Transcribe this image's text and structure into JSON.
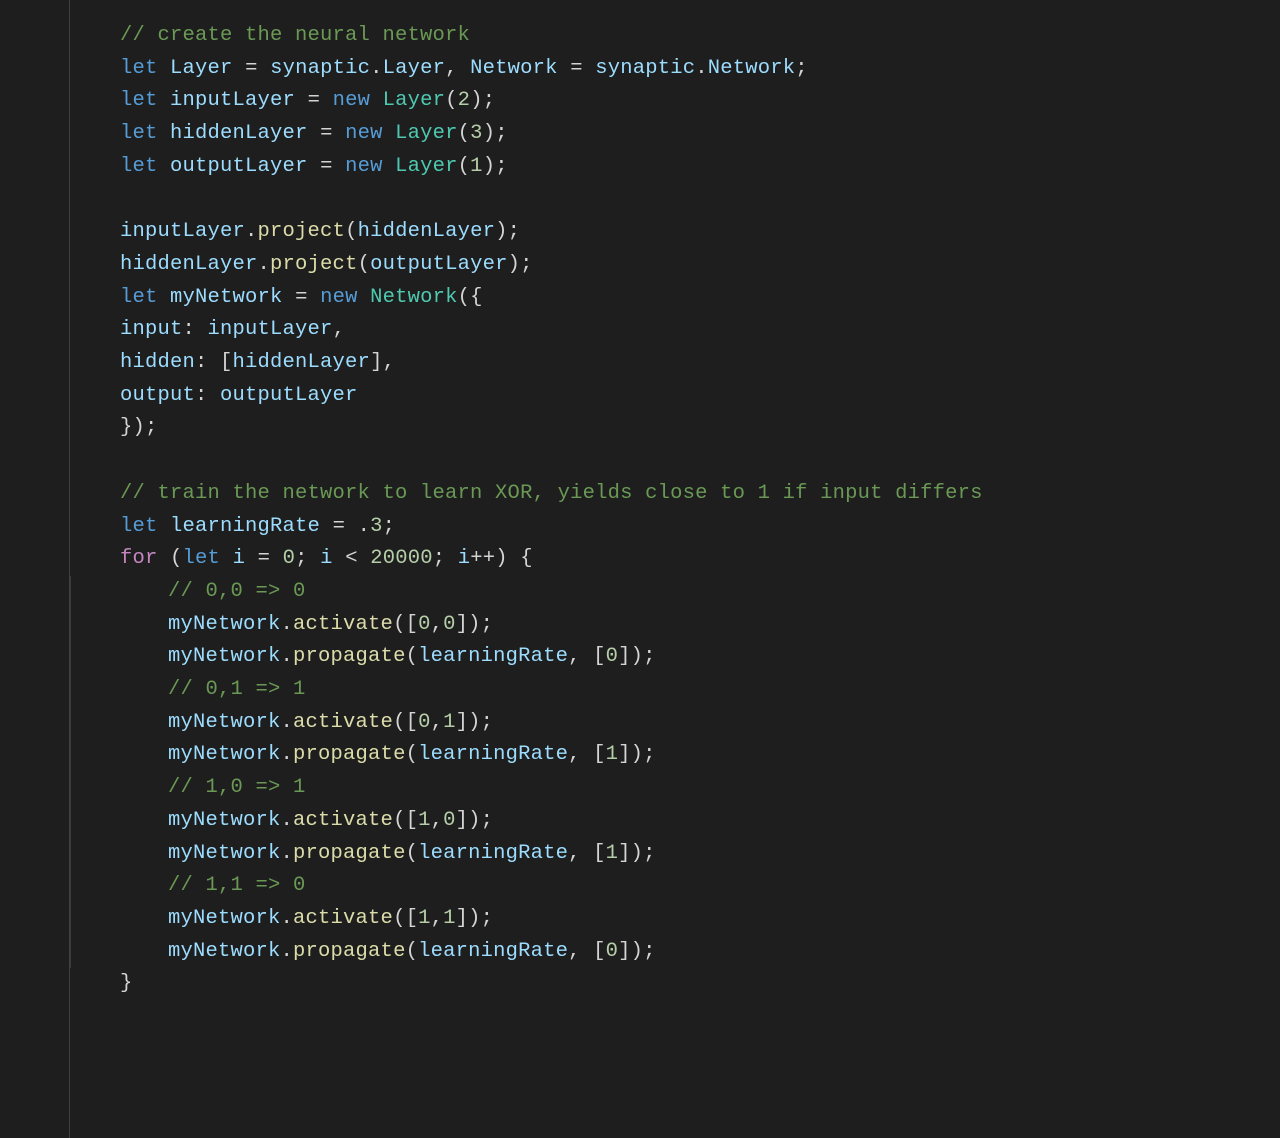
{
  "language": "javascript",
  "theme": "vscode-dark-plus",
  "colors": {
    "background": "#1e1e1e",
    "gutter_border": "#404040",
    "indent_guide": "#3a3a3a",
    "comment": "#6a9955",
    "keyword": "#569cd6",
    "control": "#c586c0",
    "type": "#4ec9b0",
    "variable": "#9cdcfe",
    "function": "#dcdcaa",
    "number": "#b5cea8",
    "punctuation": "#d4d4d4"
  },
  "lines": [
    {
      "indent": 0,
      "tokens": [
        {
          "t": "comment",
          "v": "// create the neural network"
        }
      ]
    },
    {
      "indent": 0,
      "tokens": [
        {
          "t": "keyword",
          "v": "let"
        },
        {
          "t": "plain",
          "v": " "
        },
        {
          "t": "var",
          "v": "Layer"
        },
        {
          "t": "plain",
          "v": " "
        },
        {
          "t": "punct",
          "v": "="
        },
        {
          "t": "plain",
          "v": " "
        },
        {
          "t": "var",
          "v": "synaptic"
        },
        {
          "t": "punct",
          "v": "."
        },
        {
          "t": "var",
          "v": "Layer"
        },
        {
          "t": "punct",
          "v": ", "
        },
        {
          "t": "var",
          "v": "Network"
        },
        {
          "t": "plain",
          "v": " "
        },
        {
          "t": "punct",
          "v": "="
        },
        {
          "t": "plain",
          "v": " "
        },
        {
          "t": "var",
          "v": "synaptic"
        },
        {
          "t": "punct",
          "v": "."
        },
        {
          "t": "var",
          "v": "Network"
        },
        {
          "t": "punct",
          "v": ";"
        }
      ]
    },
    {
      "indent": 0,
      "tokens": [
        {
          "t": "keyword",
          "v": "let"
        },
        {
          "t": "plain",
          "v": " "
        },
        {
          "t": "var",
          "v": "inputLayer"
        },
        {
          "t": "plain",
          "v": " "
        },
        {
          "t": "punct",
          "v": "="
        },
        {
          "t": "plain",
          "v": " "
        },
        {
          "t": "keyword",
          "v": "new"
        },
        {
          "t": "plain",
          "v": " "
        },
        {
          "t": "type",
          "v": "Layer"
        },
        {
          "t": "punct",
          "v": "("
        },
        {
          "t": "num",
          "v": "2"
        },
        {
          "t": "punct",
          "v": ");"
        }
      ]
    },
    {
      "indent": 0,
      "tokens": [
        {
          "t": "keyword",
          "v": "let"
        },
        {
          "t": "plain",
          "v": " "
        },
        {
          "t": "var",
          "v": "hiddenLayer"
        },
        {
          "t": "plain",
          "v": " "
        },
        {
          "t": "punct",
          "v": "="
        },
        {
          "t": "plain",
          "v": " "
        },
        {
          "t": "keyword",
          "v": "new"
        },
        {
          "t": "plain",
          "v": " "
        },
        {
          "t": "type",
          "v": "Layer"
        },
        {
          "t": "punct",
          "v": "("
        },
        {
          "t": "num",
          "v": "3"
        },
        {
          "t": "punct",
          "v": ");"
        }
      ]
    },
    {
      "indent": 0,
      "tokens": [
        {
          "t": "keyword",
          "v": "let"
        },
        {
          "t": "plain",
          "v": " "
        },
        {
          "t": "var",
          "v": "outputLayer"
        },
        {
          "t": "plain",
          "v": " "
        },
        {
          "t": "punct",
          "v": "="
        },
        {
          "t": "plain",
          "v": " "
        },
        {
          "t": "keyword",
          "v": "new"
        },
        {
          "t": "plain",
          "v": " "
        },
        {
          "t": "type",
          "v": "Layer"
        },
        {
          "t": "punct",
          "v": "("
        },
        {
          "t": "num",
          "v": "1"
        },
        {
          "t": "punct",
          "v": ");"
        }
      ]
    },
    {
      "indent": 0,
      "tokens": [
        {
          "t": "plain",
          "v": " "
        }
      ]
    },
    {
      "indent": 0,
      "tokens": [
        {
          "t": "var",
          "v": "inputLayer"
        },
        {
          "t": "punct",
          "v": "."
        },
        {
          "t": "func",
          "v": "project"
        },
        {
          "t": "punct",
          "v": "("
        },
        {
          "t": "var",
          "v": "hiddenLayer"
        },
        {
          "t": "punct",
          "v": ");"
        }
      ]
    },
    {
      "indent": 0,
      "tokens": [
        {
          "t": "var",
          "v": "hiddenLayer"
        },
        {
          "t": "punct",
          "v": "."
        },
        {
          "t": "func",
          "v": "project"
        },
        {
          "t": "punct",
          "v": "("
        },
        {
          "t": "var",
          "v": "outputLayer"
        },
        {
          "t": "punct",
          "v": ");"
        }
      ]
    },
    {
      "indent": 0,
      "tokens": [
        {
          "t": "keyword",
          "v": "let"
        },
        {
          "t": "plain",
          "v": " "
        },
        {
          "t": "var",
          "v": "myNetwork"
        },
        {
          "t": "plain",
          "v": " "
        },
        {
          "t": "punct",
          "v": "="
        },
        {
          "t": "plain",
          "v": " "
        },
        {
          "t": "keyword",
          "v": "new"
        },
        {
          "t": "plain",
          "v": " "
        },
        {
          "t": "type",
          "v": "Network"
        },
        {
          "t": "punct",
          "v": "({"
        }
      ]
    },
    {
      "indent": 0,
      "tokens": [
        {
          "t": "var",
          "v": "input"
        },
        {
          "t": "punct",
          "v": ": "
        },
        {
          "t": "var",
          "v": "inputLayer"
        },
        {
          "t": "punct",
          "v": ","
        }
      ]
    },
    {
      "indent": 0,
      "tokens": [
        {
          "t": "var",
          "v": "hidden"
        },
        {
          "t": "punct",
          "v": ": ["
        },
        {
          "t": "var",
          "v": "hiddenLayer"
        },
        {
          "t": "punct",
          "v": "],"
        }
      ]
    },
    {
      "indent": 0,
      "tokens": [
        {
          "t": "var",
          "v": "output"
        },
        {
          "t": "punct",
          "v": ": "
        },
        {
          "t": "var",
          "v": "outputLayer"
        }
      ]
    },
    {
      "indent": 0,
      "tokens": [
        {
          "t": "punct",
          "v": "});"
        }
      ]
    },
    {
      "indent": 0,
      "tokens": [
        {
          "t": "plain",
          "v": " "
        }
      ]
    },
    {
      "indent": 0,
      "tokens": [
        {
          "t": "comment",
          "v": "// train the network to learn XOR, yields close to 1 if input differs"
        }
      ]
    },
    {
      "indent": 0,
      "tokens": [
        {
          "t": "keyword",
          "v": "let"
        },
        {
          "t": "plain",
          "v": " "
        },
        {
          "t": "var",
          "v": "learningRate"
        },
        {
          "t": "plain",
          "v": " "
        },
        {
          "t": "punct",
          "v": "="
        },
        {
          "t": "plain",
          "v": " "
        },
        {
          "t": "punct",
          "v": "."
        },
        {
          "t": "num",
          "v": "3"
        },
        {
          "t": "punct",
          "v": ";"
        }
      ]
    },
    {
      "indent": 0,
      "tokens": [
        {
          "t": "control",
          "v": "for"
        },
        {
          "t": "plain",
          "v": " "
        },
        {
          "t": "punct",
          "v": "("
        },
        {
          "t": "keyword",
          "v": "let"
        },
        {
          "t": "plain",
          "v": " "
        },
        {
          "t": "var",
          "v": "i"
        },
        {
          "t": "plain",
          "v": " "
        },
        {
          "t": "punct",
          "v": "="
        },
        {
          "t": "plain",
          "v": " "
        },
        {
          "t": "num",
          "v": "0"
        },
        {
          "t": "punct",
          "v": "; "
        },
        {
          "t": "var",
          "v": "i"
        },
        {
          "t": "plain",
          "v": " "
        },
        {
          "t": "punct",
          "v": "<"
        },
        {
          "t": "plain",
          "v": " "
        },
        {
          "t": "num",
          "v": "20000"
        },
        {
          "t": "punct",
          "v": "; "
        },
        {
          "t": "var",
          "v": "i"
        },
        {
          "t": "punct",
          "v": "++) {"
        }
      ]
    },
    {
      "indent": 1,
      "tokens": [
        {
          "t": "comment",
          "v": "// 0,0 => 0"
        }
      ]
    },
    {
      "indent": 1,
      "tokens": [
        {
          "t": "var",
          "v": "myNetwork"
        },
        {
          "t": "punct",
          "v": "."
        },
        {
          "t": "func",
          "v": "activate"
        },
        {
          "t": "punct",
          "v": "(["
        },
        {
          "t": "num",
          "v": "0"
        },
        {
          "t": "punct",
          "v": ","
        },
        {
          "t": "num",
          "v": "0"
        },
        {
          "t": "punct",
          "v": "]);"
        }
      ]
    },
    {
      "indent": 1,
      "tokens": [
        {
          "t": "var",
          "v": "myNetwork"
        },
        {
          "t": "punct",
          "v": "."
        },
        {
          "t": "func",
          "v": "propagate"
        },
        {
          "t": "punct",
          "v": "("
        },
        {
          "t": "var",
          "v": "learningRate"
        },
        {
          "t": "punct",
          "v": ", ["
        },
        {
          "t": "num",
          "v": "0"
        },
        {
          "t": "punct",
          "v": "]);"
        }
      ]
    },
    {
      "indent": 1,
      "tokens": [
        {
          "t": "comment",
          "v": "// 0,1 => 1"
        }
      ]
    },
    {
      "indent": 1,
      "tokens": [
        {
          "t": "var",
          "v": "myNetwork"
        },
        {
          "t": "punct",
          "v": "."
        },
        {
          "t": "func",
          "v": "activate"
        },
        {
          "t": "punct",
          "v": "(["
        },
        {
          "t": "num",
          "v": "0"
        },
        {
          "t": "punct",
          "v": ","
        },
        {
          "t": "num",
          "v": "1"
        },
        {
          "t": "punct",
          "v": "]);"
        }
      ]
    },
    {
      "indent": 1,
      "tokens": [
        {
          "t": "var",
          "v": "myNetwork"
        },
        {
          "t": "punct",
          "v": "."
        },
        {
          "t": "func",
          "v": "propagate"
        },
        {
          "t": "punct",
          "v": "("
        },
        {
          "t": "var",
          "v": "learningRate"
        },
        {
          "t": "punct",
          "v": ", ["
        },
        {
          "t": "num",
          "v": "1"
        },
        {
          "t": "punct",
          "v": "]);"
        }
      ]
    },
    {
      "indent": 1,
      "tokens": [
        {
          "t": "comment",
          "v": "// 1,0 => 1"
        }
      ]
    },
    {
      "indent": 1,
      "tokens": [
        {
          "t": "var",
          "v": "myNetwork"
        },
        {
          "t": "punct",
          "v": "."
        },
        {
          "t": "func",
          "v": "activate"
        },
        {
          "t": "punct",
          "v": "(["
        },
        {
          "t": "num",
          "v": "1"
        },
        {
          "t": "punct",
          "v": ","
        },
        {
          "t": "num",
          "v": "0"
        },
        {
          "t": "punct",
          "v": "]);"
        }
      ]
    },
    {
      "indent": 1,
      "tokens": [
        {
          "t": "var",
          "v": "myNetwork"
        },
        {
          "t": "punct",
          "v": "."
        },
        {
          "t": "func",
          "v": "propagate"
        },
        {
          "t": "punct",
          "v": "("
        },
        {
          "t": "var",
          "v": "learningRate"
        },
        {
          "t": "punct",
          "v": ", ["
        },
        {
          "t": "num",
          "v": "1"
        },
        {
          "t": "punct",
          "v": "]);"
        }
      ]
    },
    {
      "indent": 1,
      "tokens": [
        {
          "t": "comment",
          "v": "// 1,1 => 0"
        }
      ]
    },
    {
      "indent": 1,
      "tokens": [
        {
          "t": "var",
          "v": "myNetwork"
        },
        {
          "t": "punct",
          "v": "."
        },
        {
          "t": "func",
          "v": "activate"
        },
        {
          "t": "punct",
          "v": "(["
        },
        {
          "t": "num",
          "v": "1"
        },
        {
          "t": "punct",
          "v": ","
        },
        {
          "t": "num",
          "v": "1"
        },
        {
          "t": "punct",
          "v": "]);"
        }
      ]
    },
    {
      "indent": 1,
      "tokens": [
        {
          "t": "var",
          "v": "myNetwork"
        },
        {
          "t": "punct",
          "v": "."
        },
        {
          "t": "func",
          "v": "propagate"
        },
        {
          "t": "punct",
          "v": "("
        },
        {
          "t": "var",
          "v": "learningRate"
        },
        {
          "t": "punct",
          "v": ", ["
        },
        {
          "t": "num",
          "v": "0"
        },
        {
          "t": "punct",
          "v": "]);"
        }
      ]
    },
    {
      "indent": 0,
      "tokens": [
        {
          "t": "punct",
          "v": "}"
        }
      ]
    }
  ]
}
